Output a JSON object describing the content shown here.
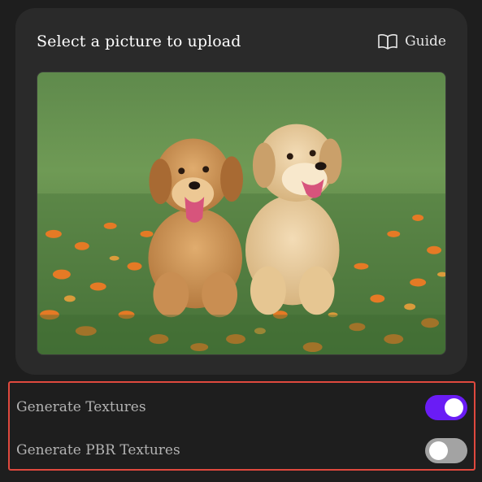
{
  "upload_card": {
    "title": "Select a picture to upload",
    "guide_label": "Guide",
    "guide_icon": "book-icon",
    "image_alt": "two golden retriever puppies sitting in grass with orange flowers"
  },
  "options": [
    {
      "label": "Generate Textures",
      "enabled": true
    },
    {
      "label": "Generate PBR Textures",
      "enabled": false
    }
  ],
  "colors": {
    "toggle_on": "#6a1cf5",
    "toggle_off": "#a3a3a3",
    "highlight_border": "#e0493e"
  }
}
